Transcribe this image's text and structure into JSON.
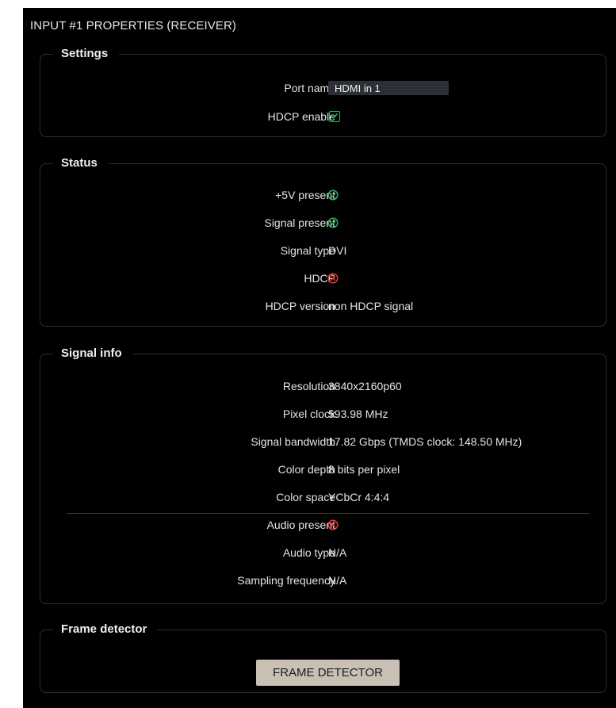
{
  "panel": {
    "title": "INPUT #1 PROPERTIES (RECEIVER)"
  },
  "settings": {
    "legend": "Settings",
    "port_name_label": "Port name",
    "port_name_value": "HDMI in 1",
    "hdcp_enable_label": "HDCP enable",
    "hdcp_enable_checked": true
  },
  "status": {
    "legend": "Status",
    "plus5v_label": "+5V present",
    "plus5v_ok": true,
    "signal_present_label": "Signal present",
    "signal_present_ok": true,
    "signal_type_label": "Signal type",
    "signal_type_value": "DVI",
    "hdcp_label": "HDCP",
    "hdcp_ok": false,
    "hdcp_version_label": "HDCP version",
    "hdcp_version_value": "non HDCP signal"
  },
  "signal_info": {
    "legend": "Signal info",
    "resolution_label": "Resolution",
    "resolution_value": "3840x2160p60",
    "pixel_clock_label": "Pixel clock",
    "pixel_clock_value": "593.98 MHz",
    "bandwidth_label": "Signal bandwidth",
    "bandwidth_value": "17.82 Gbps (TMDS clock: 148.50 MHz)",
    "color_depth_label": "Color depth",
    "color_depth_value": "8 bits per pixel",
    "color_space_label": "Color space",
    "color_space_value": "YCbCr 4:4:4",
    "audio_present_label": "Audio present",
    "audio_present_ok": false,
    "audio_type_label": "Audio type",
    "audio_type_value": "N/A",
    "sampling_label": "Sampling frequency",
    "sampling_value": "N/A"
  },
  "frame_detector": {
    "legend": "Frame detector",
    "button_label": "FRAME DETECTOR"
  },
  "colors": {
    "panel_bg": "#000000",
    "ok_green": "#27b35c",
    "error_red": "#e53935",
    "button_bg": "#c8c0b4",
    "input_bg": "#2c2f36"
  },
  "icons": {
    "ok": "check-circle-icon",
    "error": "x-circle-icon",
    "checkbox": "checkbox-checked-icon"
  }
}
